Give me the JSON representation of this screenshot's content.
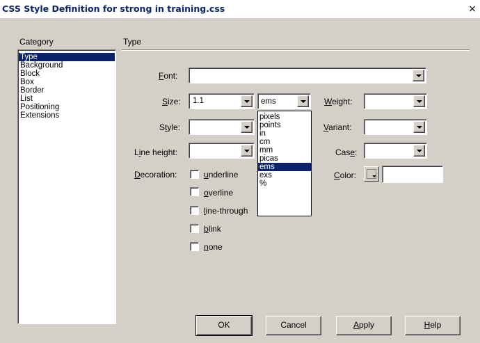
{
  "window": {
    "title": "CSS Style Definition for strong in training.css",
    "close_glyph": "×"
  },
  "category": {
    "label": "Category",
    "items": [
      "Type",
      "Background",
      "Block",
      "Box",
      "Border",
      "List",
      "Positioning",
      "Extensions"
    ],
    "selected": "Type"
  },
  "panel": {
    "label": "Type"
  },
  "font": {
    "label_accel": "F",
    "label_rest": "ont:",
    "value": ""
  },
  "size": {
    "label_accel": "S",
    "label_rest": "ize:",
    "value": "1.1",
    "unit_value": "ems",
    "unit_options": [
      "pixels",
      "points",
      "in",
      "cm",
      "mm",
      "picas",
      "ems",
      "exs",
      "%"
    ],
    "unit_selected": "ems"
  },
  "weight": {
    "label_accel": "W",
    "label_rest": "eight:",
    "value": ""
  },
  "style": {
    "label_pre": "S",
    "label_accel": "t",
    "label_rest": "yle:",
    "value": ""
  },
  "variant": {
    "label_accel": "V",
    "label_rest": "ariant:",
    "value": ""
  },
  "line_height": {
    "label_pre": "L",
    "label_accel": "i",
    "label_rest": "ne height:",
    "value": ""
  },
  "case": {
    "label_pre": "Cas",
    "label_accel": "e",
    "label_rest": ":",
    "value": ""
  },
  "decoration": {
    "label_accel": "D",
    "label_rest": "ecoration:",
    "options": [
      {
        "accel": "u",
        "rest": "nderline",
        "checked": false
      },
      {
        "accel": "o",
        "rest": "verline",
        "checked": false
      },
      {
        "accel": "l",
        "rest": "ine-through",
        "checked": false
      },
      {
        "accel": "b",
        "rest": "link",
        "checked": false
      },
      {
        "accel": "n",
        "rest": "one",
        "checked": false
      }
    ]
  },
  "color": {
    "label_accel": "C",
    "label_rest": "olor:",
    "value": ""
  },
  "buttons": {
    "ok": "OK",
    "cancel": "Cancel",
    "apply_accel": "A",
    "apply_rest": "pply",
    "help_accel": "H",
    "help_rest": "elp"
  },
  "icons": {
    "dropdown": "chevron-down-icon",
    "close": "close-icon",
    "color_picker": "color-picker-icon"
  }
}
